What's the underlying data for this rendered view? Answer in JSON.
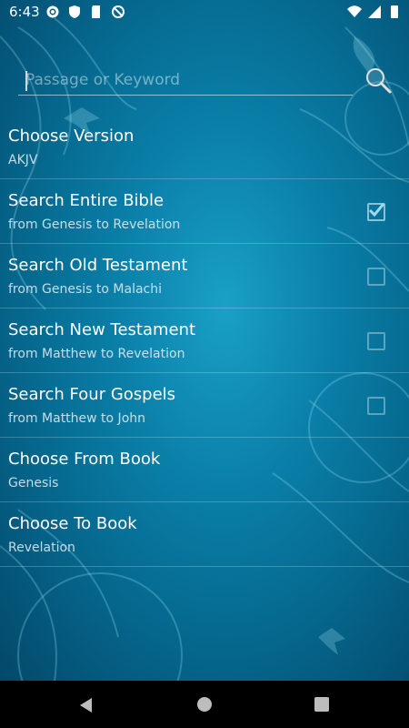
{
  "status_bar": {
    "time": "6:43",
    "left_icons": [
      "gear-icon",
      "shield-icon",
      "sd-card-icon",
      "no-sync-icon"
    ],
    "right_icons": [
      "wifi-icon",
      "signal-icon",
      "battery-icon"
    ]
  },
  "search": {
    "placeholder": "Passage or Keyword",
    "value": "",
    "button_icon": "search-icon"
  },
  "options": [
    {
      "title": "Choose Version",
      "subtitle": "AKJV"
    },
    {
      "title": "Search Entire Bible",
      "subtitle": "from Genesis to Revelation",
      "checked": true
    },
    {
      "title": "Search Old Testament",
      "subtitle": "from Genesis to Malachi",
      "checked": false
    },
    {
      "title": "Search New Testament",
      "subtitle": "from Matthew to Revelation",
      "checked": false
    },
    {
      "title": "Search Four Gospels",
      "subtitle": "from Matthew to John",
      "checked": false
    },
    {
      "title": "Choose From Book",
      "subtitle": "Genesis"
    },
    {
      "title": "Choose To Book",
      "subtitle": "Revelation"
    }
  ],
  "nav_bar": {
    "icons": [
      "back-icon",
      "home-icon",
      "recents-icon"
    ]
  },
  "colors": {
    "background": "#0a7fa8",
    "navbar": "#000000",
    "text": "#ffffff"
  }
}
